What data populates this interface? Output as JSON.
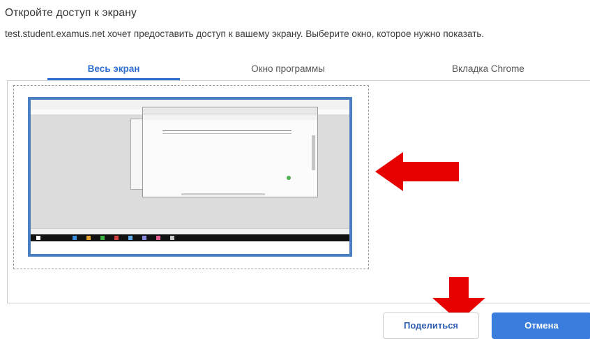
{
  "dialog": {
    "title": "Откройте доступ к экрану",
    "description": "test.student.examus.net хочет предоставить доступ к вашему экрану. Выберите окно, которое нужно показать."
  },
  "tabs": [
    {
      "label": "Весь экран",
      "active": true
    },
    {
      "label": "Окно программы",
      "active": false
    },
    {
      "label": "Вкладка Chrome",
      "active": false
    }
  ],
  "buttons": {
    "share_label": "Поделиться",
    "cancel_label": "Отмена"
  },
  "colors": {
    "accent": "#2f6fcf",
    "thumbnail_border": "#4a7fc1",
    "annotation_arrow": "#e60000",
    "cancel_button": "#3b7ddd"
  },
  "icons": {
    "annotation_left": "arrow-left-icon",
    "annotation_down": "arrow-down-icon"
  }
}
